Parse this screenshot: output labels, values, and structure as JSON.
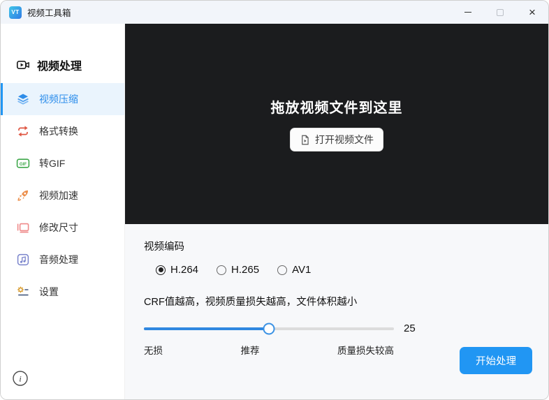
{
  "titlebar": {
    "title": "视频工具箱",
    "logo_text": "VT"
  },
  "sidebar": {
    "header": "视频处理",
    "items": [
      {
        "label": "视频压缩",
        "icon": "layers-icon",
        "selected": true
      },
      {
        "label": "格式转换",
        "icon": "swap-icon",
        "selected": false
      },
      {
        "label": "转GIF",
        "icon": "gif-icon",
        "selected": false
      },
      {
        "label": "视频加速",
        "icon": "rocket-icon",
        "selected": false
      },
      {
        "label": "修改尺寸",
        "icon": "resize-icon",
        "selected": false
      },
      {
        "label": "音频处理",
        "icon": "music-note-icon",
        "selected": false
      },
      {
        "label": "设置",
        "icon": "gear-icon",
        "selected": false
      }
    ]
  },
  "dropzone": {
    "title": "拖放视频文件到这里",
    "open_button": "打开视频文件"
  },
  "encoding": {
    "label": "视频编码",
    "options": [
      {
        "label": "H.264",
        "selected": true
      },
      {
        "label": "H.265",
        "selected": false
      },
      {
        "label": "AV1",
        "selected": false
      }
    ]
  },
  "crf": {
    "description": "CRF值越高，视频质量损失越高，文件体积越小",
    "value": "25",
    "percent": 50,
    "scale_labels": {
      "left": "无损",
      "center": "推荐",
      "right": "质量损失较高"
    }
  },
  "actions": {
    "start": "开始处理"
  },
  "colors": {
    "accent": "#2196f3",
    "selected_item": "#2a8ceb",
    "dropzone_bg": "#1b1c1e"
  }
}
